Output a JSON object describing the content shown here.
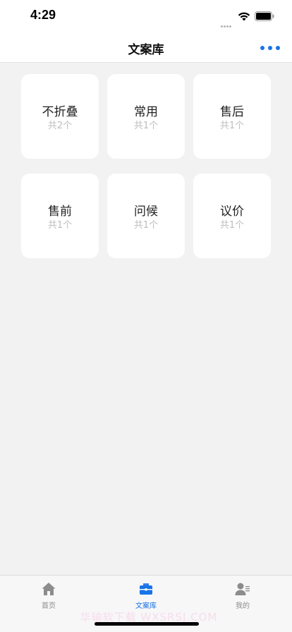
{
  "status": {
    "time": "4:29"
  },
  "nav": {
    "title": "文案库"
  },
  "cards": [
    {
      "title": "不折叠",
      "count": "共2个"
    },
    {
      "title": "常用",
      "count": "共1个"
    },
    {
      "title": "售后",
      "count": "共1个"
    },
    {
      "title": "售前",
      "count": "共1个"
    },
    {
      "title": "问候",
      "count": "共1个"
    },
    {
      "title": "议价",
      "count": "共1个"
    }
  ],
  "tabs": [
    {
      "label": "首页",
      "icon": "home-icon"
    },
    {
      "label": "文案库",
      "icon": "briefcase-icon",
      "active": true
    },
    {
      "label": "我的",
      "icon": "profile-icon"
    }
  ],
  "watermark": "华输软下载 WXSRSJ.COM",
  "colors": {
    "accent": "#1a73e8",
    "background": "#f2f2f2"
  }
}
